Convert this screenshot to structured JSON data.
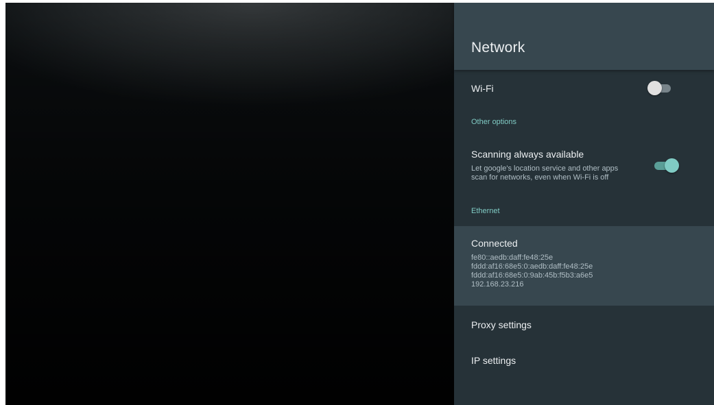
{
  "panel": {
    "title": "Network"
  },
  "wifi": {
    "label": "Wi-Fi",
    "enabled": false
  },
  "other_options": {
    "header": "Other options"
  },
  "scanning": {
    "label": "Scanning always available",
    "description_line1": "Let google's location service and other apps",
    "description_line2": "scan for networks, even when Wi-Fi is off",
    "enabled": true
  },
  "ethernet": {
    "header": "Ethernet",
    "status": "Connected",
    "addresses": [
      "fe80::aedb:daff:fe48:25e",
      "fddd:af16:68e5:0:aedb:daff:fe48:25e",
      "fddd:af16:68e5:0:9ab:45b:f5b3:a6e5",
      "192.168.23.216"
    ]
  },
  "proxy": {
    "label": "Proxy settings"
  },
  "ip": {
    "label": "IP settings"
  },
  "colors": {
    "panel_bg": "#263238",
    "header_bg": "#37474f",
    "accent": "#80cbc4",
    "toggle_off_thumb": "#e0e0e0"
  }
}
